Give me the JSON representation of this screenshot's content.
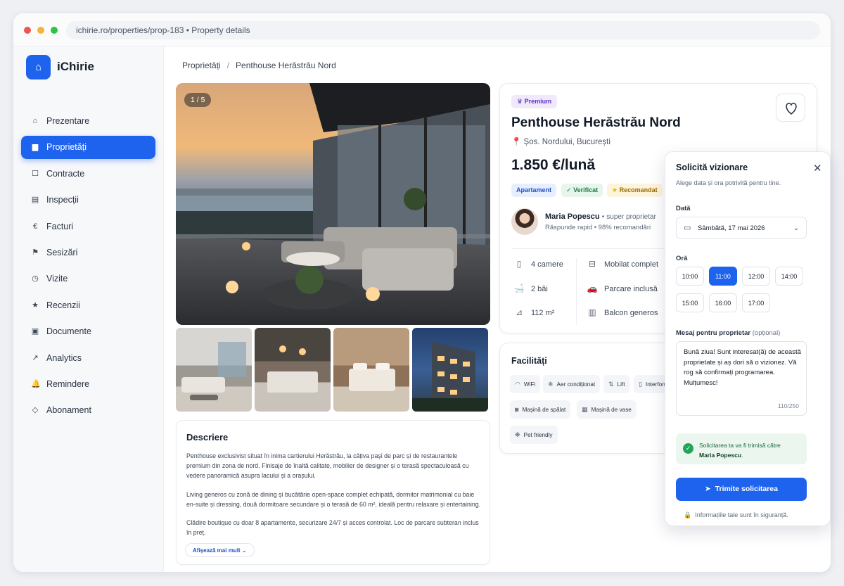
{
  "browser": {
    "url": "ichirie.ro/properties/prop-183 • Property details"
  },
  "app": {
    "name": "iChirie",
    "logo_icon": "home-icon"
  },
  "sidebar": {
    "items": [
      {
        "label": "Prezentare",
        "icon": "home-icon",
        "glyph": "⌂",
        "active": false
      },
      {
        "label": "Proprietăți",
        "icon": "building-icon",
        "glyph": "▆",
        "active": true
      },
      {
        "label": "Contracte",
        "icon": "contract-icon",
        "glyph": "☐",
        "active": false
      },
      {
        "label": "Inspecții",
        "icon": "inspection-icon",
        "glyph": "▤",
        "active": false
      },
      {
        "label": "Facturi",
        "icon": "euro-icon",
        "glyph": "€",
        "active": false
      },
      {
        "label": "Sesizări",
        "icon": "flag-icon",
        "glyph": "⚑",
        "active": false
      },
      {
        "label": "Vizite",
        "icon": "clock-icon",
        "glyph": "◷",
        "active": false
      },
      {
        "label": "Recenzii",
        "icon": "star-icon",
        "glyph": "★",
        "active": false
      },
      {
        "label": "Documente",
        "icon": "document-icon",
        "glyph": "▣",
        "active": false
      },
      {
        "label": "Analytics",
        "icon": "trend-icon",
        "glyph": "↗",
        "active": false
      },
      {
        "label": "Remindere",
        "icon": "bell-icon",
        "glyph": "🔔",
        "active": false
      },
      {
        "label": "Abonament",
        "icon": "diamond-icon",
        "glyph": "◇",
        "active": false
      }
    ]
  },
  "breadcrumb": {
    "parent": "Proprietăți",
    "separator": "/",
    "current": "Penthouse Herăstrău Nord"
  },
  "gallery": {
    "counter": "1 / 5"
  },
  "description": {
    "title": "Descriere",
    "p1": "Penthouse exclusivist situat în inima cartierului Herăstrău, la câțiva pași de parc și de restaurantele premium din zona de nord. Finisaje de înaltă calitate, mobilier de designer și o terasă spectaculoasă cu vedere panoramică asupra lacului și a orașului.",
    "p2": "Living generos cu zonă de dining și bucătărie open-space complet echipată, dormitor matrimonial cu baie en-suite și dressing, două dormitoare secundare și o terasă de 60 m², ideală pentru relaxare și entertaining.",
    "p3": "Clădire boutique cu doar 8 apartamente, securizare 24/7 și acces controlat. Loc de parcare subteran inclus în preț.",
    "more": "Afișează mai mult"
  },
  "property": {
    "badge": "Premium",
    "title": "Penthouse Herăstrău Nord",
    "address": "Șos. Nordului, București",
    "price": "1.850 €/lună",
    "tags": [
      "Apartament",
      "Verificat",
      "Recomandat"
    ],
    "owner_name": "Maria Popescu",
    "owner_tag": "super proprietar",
    "owner_sub": "Răspunde rapid • 98% recomandări",
    "features_left": [
      "4 camere",
      "2 băi",
      "112 m²"
    ],
    "features_right": [
      "Mobilat complet",
      "Parcare inclusă",
      "Balcon generos"
    ]
  },
  "amenities": {
    "title": "Facilități",
    "items": [
      "WiFi",
      "Aer condiționat",
      "Lift",
      "Interfon",
      "Mașină de spălat",
      "Mașină de vase",
      "Pet friendly"
    ]
  },
  "booking": {
    "title": "Solicită vizionare",
    "subtitle": "Alege data și ora potrivită pentru tine.",
    "date_label": "Dată",
    "date_value": "Sâmbătă, 17 mai 2026",
    "time_label": "Oră",
    "slots": [
      "10:00",
      "11:00",
      "12:00",
      "14:00",
      "15:00",
      "16:00",
      "17:00"
    ],
    "selected_slot": "11:00",
    "message_label": "Mesaj pentru proprietar",
    "message_optional": "(opțional)",
    "message_value": "Bună ziua! Sunt interesat(ă) de această proprietate și aș dori să o vizionez. Vă rog să confirmați programarea. Mulțumesc!",
    "message_count": "110/250",
    "notice_text": "Solicitarea ta va fi trimisă către",
    "notice_owner": "Maria Popescu",
    "notice_end": ".",
    "submit": "Trimite solicitarea",
    "secure": "Informațiile tale sunt în siguranță."
  },
  "colors": {
    "accent": "#1e63ee",
    "success": "#22a55b",
    "premium": "#5b33c6"
  }
}
